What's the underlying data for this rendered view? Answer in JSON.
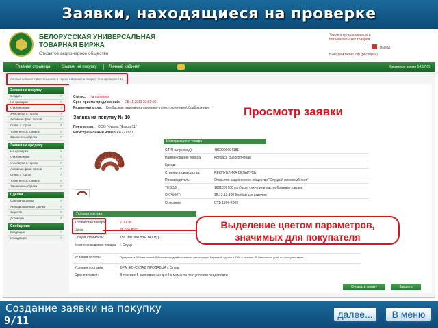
{
  "slide": {
    "title": "Заявки, находящиеся на проверке",
    "callout_title": "Просмотр заявки",
    "callout_box": [
      "Выделение цветом параметров,",
      "значимых для покупателя"
    ],
    "footer_title": "Создание заявки на покупку",
    "footer_page": "9/11",
    "next_button": "далее...",
    "menu_button": "В меню"
  },
  "header": {
    "logo_line1": "БЕЛОРУССКАЯ УНИВЕРСАЛЬНАЯ",
    "logo_line2": "ТОВАРНАЯ БИРЖА",
    "logo_sub": "Открытое акционерное общество",
    "links": [
      "Закупка промышленных и",
      "потребительских товаров",
      "Выход",
      "Выводим БелиСоф (ресторан)"
    ]
  },
  "nav": {
    "items": [
      "Главная страница",
      "Заявки на покупку",
      "Личный кабинет"
    ],
    "time": "Биржевое время 14:17:09"
  },
  "breadcrumb": "Личный кабинет / Деятельность в торгах / Заявки на покупку / На проверке / 10",
  "sidebar": {
    "sections": [
      {
        "title": "Заявки на покупку",
        "items": [
          "Создать",
          "На проверке",
          "Отклоненные",
          "Участвуют в торгах",
          "Активная фаза торгов",
          "Снять с торгов",
          "Торги не состоялись",
          "Заключены сделки"
        ]
      },
      {
        "title": "Заявки на продажу",
        "items": [
          "На проверке",
          "Отклоненные",
          "Участвуют в торгах",
          "Активная фаза торгов",
          "Снять с торгов",
          "Торги не состоялись",
          "Заключены сделки"
        ]
      },
      {
        "title": "Сделки",
        "items": [
          "Сделки-акцепты",
          "Аннулированные сделки",
          "акцепты",
          "Договоры"
        ]
      },
      {
        "title": "Сообщения",
        "items": [
          "Входящие",
          "Исходящие"
        ]
      }
    ]
  },
  "order": {
    "status_label": "Статус:",
    "status_value": "На проверке",
    "deadline_label": "Срок приема предложений:",
    "deadline_value": "25.11.2013 23:59:00",
    "section_label": "Раздел каталога:",
    "section_value": "Колбасные изделия из свинины - приготовленные/обработанные",
    "heading": "Заявка на покупку № 10",
    "buyer_label": "Покупатель:",
    "buyer_value": "ООО \"Фирма \"Факор-11\"",
    "reg_label": "Регистрационный номер:",
    "reg_value": "006227320"
  },
  "product_info": {
    "title": "Информация о товаре",
    "rows": [
      {
        "label": "GTIN (штрихкод):",
        "value": "4810000004181"
      },
      {
        "label": "Наименование товара:",
        "value": "Колбаса сырокопченая"
      },
      {
        "label": "Бренд:",
        "value": ""
      },
      {
        "label": "Страна производства:",
        "value": "РЕСПУБЛИКА БЕЛАРУСЬ"
      },
      {
        "label": "Производитель:",
        "value": "Открытое акционерное общество \"Слуцкий мясокомбинат\""
      },
      {
        "label": "ТНВЭД:",
        "value": "1601009100 колбасы, сухие или пастообразные, сырые"
      },
      {
        "label": "ОКРБ007:",
        "value": "15.13.12.100 Колбасные изделия"
      },
      {
        "label": "Описание:",
        "value": "СТБ 1996-2009"
      }
    ]
  },
  "terms": {
    "title": "Условия покупки",
    "rows": [
      {
        "label": "Количество товара:",
        "value": "2 000 кг",
        "highlight": true
      },
      {
        "label": "Цена:",
        "value": "78 000 BYR",
        "highlight": true
      },
      {
        "label": "Общая стоимость:",
        "value": "156 000 000 BYR без НДС",
        "highlight": false
      },
      {
        "label": "Местонахождение товара:",
        "value": "г. Слуцк",
        "highlight": false
      },
      {
        "label": "Условия оплаты:",
        "value": "Предоплата 30% в течение 5 банковских дней с момента регистрации биржевой сделки и 70% в течение 30 банковских дней по факту поставки",
        "highlight": false
      },
      {
        "label": "Условия поставки:",
        "value": "ФРАНКО-СКЛАД ПРОДАВЦА г. Слуцк",
        "highlight": false
      },
      {
        "label": "Срок поставки:",
        "value": "В течение 5 календарных дней с момента поступления предоплаты",
        "highlight": false
      }
    ],
    "withdraw_button": "Отозвать заявку",
    "close_button": "Закрыть"
  },
  "colors": {
    "slide_blue": "#0d4a78",
    "site_green": "#1f6a2c",
    "highlight_red": "#e0101c",
    "value_red": "#c0272d"
  }
}
